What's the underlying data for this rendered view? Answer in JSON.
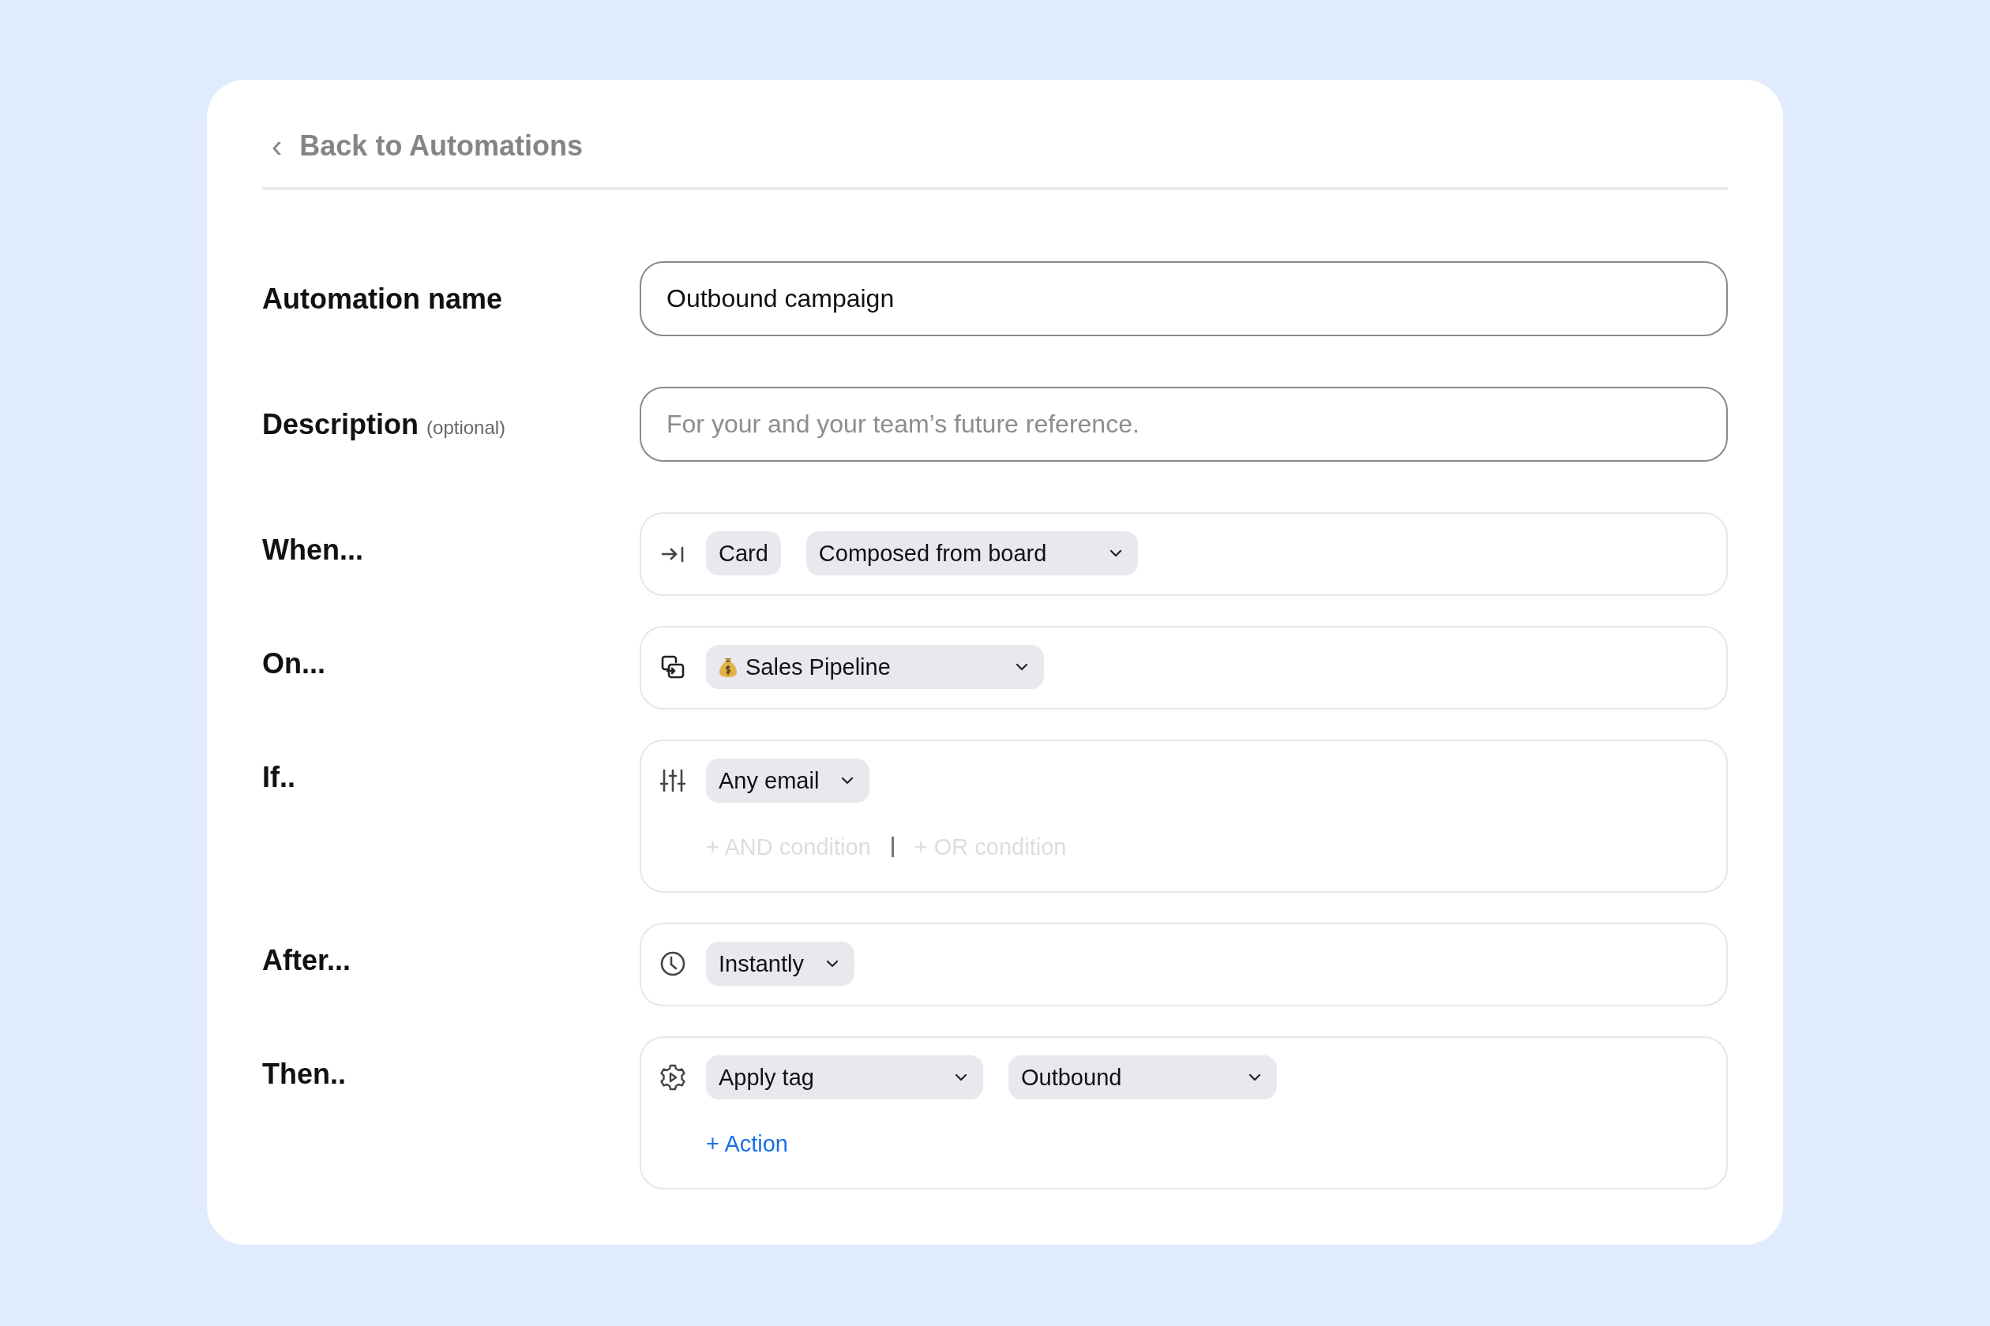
{
  "back_link": {
    "icon": "‹",
    "label": "Back to Automations"
  },
  "name_field": {
    "label": "Automation name",
    "value": "Outbound campaign"
  },
  "description_field": {
    "label": "Description",
    "hint": "(optional)",
    "placeholder": "For your and your team’s future reference."
  },
  "steps": [
    {
      "kind": "trigger",
      "label": "When...",
      "chips": [
        {
          "text": "Card",
          "dropdown": false
        },
        {
          "text": "Composed from board",
          "dropdown": true
        }
      ]
    },
    {
      "kind": "board",
      "label": "On...",
      "chips": [
        {
          "text": "Sales Pipeline",
          "dropdown": true
        }
      ]
    },
    {
      "kind": "condition",
      "label": "If..",
      "chips": [
        {
          "text": "Any email",
          "dropdown": true
        }
      ],
      "links": [
        {
          "text": "+ AND condition",
          "disabled": true
        },
        {
          "text": "+ OR condition",
          "disabled": true
        }
      ]
    },
    {
      "kind": "delay",
      "label": "After...",
      "chips": [
        {
          "text": "Instantly",
          "dropdown": true
        }
      ]
    },
    {
      "kind": "action",
      "label": "Then..",
      "chips": [
        {
          "text": "Apply tag",
          "dropdown": true
        },
        {
          "text": "Outbound",
          "dropdown": true
        }
      ],
      "links": [
        {
          "text": "+ Action",
          "disabled": false
        }
      ]
    }
  ]
}
